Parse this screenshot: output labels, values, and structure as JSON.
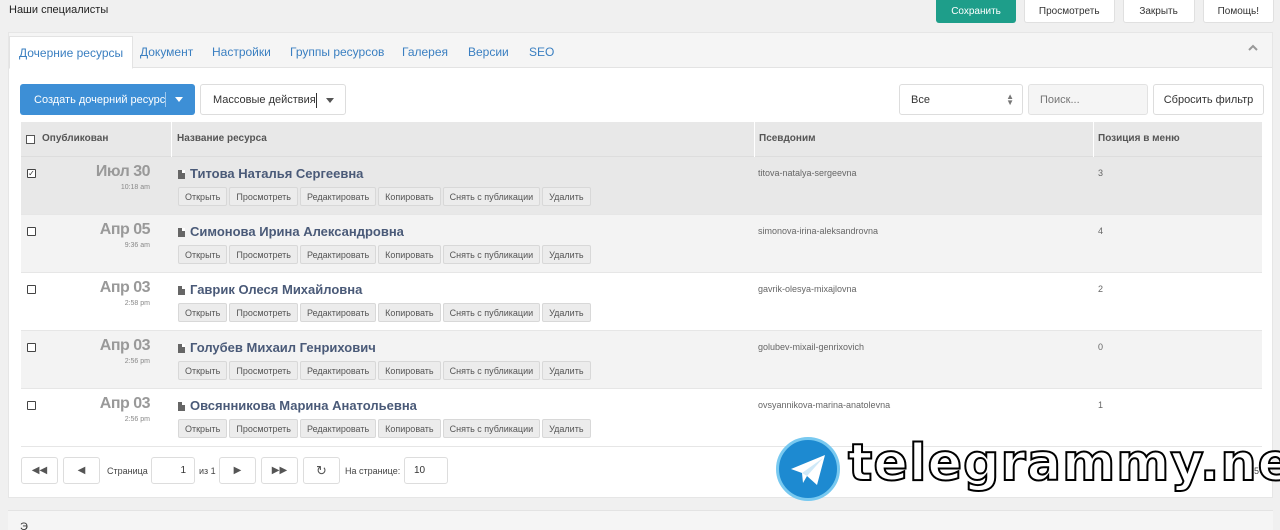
{
  "header": {
    "title": "Наши специалисты",
    "buttons": {
      "save": "Сохранить",
      "view": "Просмотреть",
      "close": "Закрыть",
      "help": "Помощь!"
    }
  },
  "tabs": [
    {
      "label": "Дочерние ресурсы",
      "active": true
    },
    {
      "label": "Документ"
    },
    {
      "label": "Настройки"
    },
    {
      "label": "Группы ресурсов"
    },
    {
      "label": "Галерея"
    },
    {
      "label": "Версии"
    },
    {
      "label": "SEO"
    }
  ],
  "toolbar": {
    "create_label": "Создать дочерний ресурс",
    "mass_label": "Массовые действия",
    "filter_value": "Все",
    "search_placeholder": "Поиск...",
    "reset_label": "Сбросить фильтр"
  },
  "grid": {
    "columns": {
      "published": "Опубликован",
      "name": "Название ресурса",
      "alias": "Псевдоним",
      "menu_position": "Позиция в меню"
    },
    "action_labels": {
      "open": "Открыть",
      "view": "Просмотреть",
      "edit": "Редактировать",
      "copy": "Копировать",
      "unpublish": "Снять с публикации",
      "delete": "Удалить"
    },
    "rows": [
      {
        "checked": true,
        "date": "Июл 30",
        "time": "10:18 am",
        "name": "Титова Наталья Сергеевна",
        "alias": "titova-natalya-sergeevna",
        "position": "3"
      },
      {
        "checked": false,
        "date": "Апр 05",
        "time": "9:36 am",
        "name": "Симонова Ирина Александровна",
        "alias": "simonova-irina-aleksandrovna",
        "position": "4"
      },
      {
        "checked": false,
        "date": "Апр 03",
        "time": "2:58 pm",
        "name": "Гаврик Олеся Михайловна",
        "alias": "gavrik-olesya-mixajlovna",
        "position": "2"
      },
      {
        "checked": false,
        "date": "Апр 03",
        "time": "2:56 pm",
        "name": "Голубев Михаил Генрихович",
        "alias": "golubev-mixail-genrixovich",
        "position": "0"
      },
      {
        "checked": false,
        "date": "Апр 03",
        "time": "2:56 pm",
        "name": "Овсянникова Марина Анатольевна",
        "alias": "ovsyannikova-marina-anatolevna",
        "position": "1"
      }
    ]
  },
  "pager": {
    "page_label": "Страница",
    "page_value": "1",
    "of_label": "из 1",
    "per_page_label": "На странице:",
    "per_page_value": "10",
    "right_text": "5"
  },
  "watermark": {
    "text": "telegrammy.net"
  },
  "bottom": {
    "text": "Э"
  }
}
